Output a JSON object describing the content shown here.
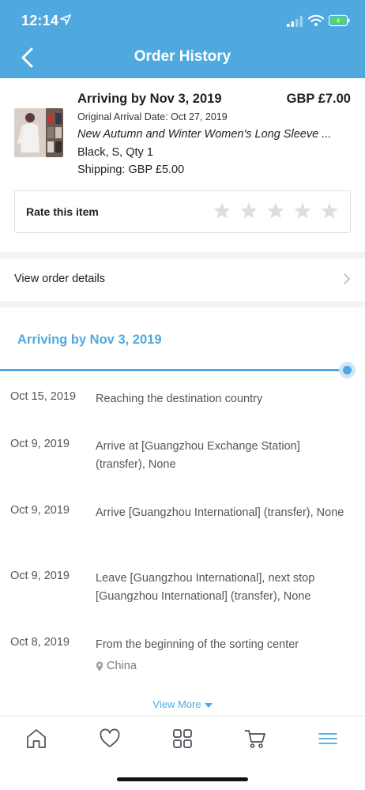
{
  "status_bar": {
    "time": "12:14"
  },
  "header": {
    "title": "Order History",
    "back_icon": "chevron-left-icon"
  },
  "order": {
    "arrival_title": "Arriving by Nov 3, 2019",
    "price": "GBP £7.00",
    "original_arrival": "Original Arrival Date: Oct 27, 2019",
    "product_name": "New Autumn and Winter Women's Long Sleeve ...",
    "variant": "Black, S, Qty 1",
    "shipping": "Shipping: GBP £5.00",
    "rate_label": "Rate this item",
    "rating": 0,
    "rating_max": 5
  },
  "details": {
    "label": "View order details"
  },
  "tracking": {
    "title": "Arriving by Nov 3, 2019",
    "progress": 1.0,
    "events": [
      {
        "date": "Oct 15, 2019",
        "description": "Reaching the destination country"
      },
      {
        "date": "Oct 9, 2019",
        "description": "Arrive at [Guangzhou Exchange Station] (transfer), None"
      },
      {
        "date": "Oct 9, 2019",
        "description": "Arrive [Guangzhou International] (transfer), None"
      },
      {
        "date": "Oct 9, 2019",
        "description": "Leave [Guangzhou International], next stop [Guangzhou International] (transfer), None"
      },
      {
        "date": "Oct 8, 2019",
        "description": "From the beginning of the sorting center",
        "location": "China"
      }
    ],
    "view_more": "View More"
  },
  "tabbar": {
    "items": [
      "home-icon",
      "heart-icon",
      "grid-icon",
      "cart-icon",
      "menu-icon"
    ],
    "active_color": "#4fa9df"
  },
  "colors": {
    "brand": "#4fa9df",
    "star": "#dcdfe2"
  }
}
